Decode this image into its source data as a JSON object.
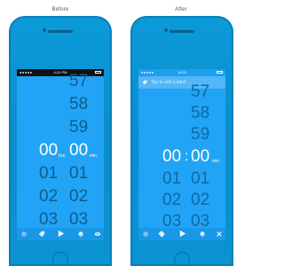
{
  "captions": {
    "before": "Before",
    "after": "After"
  },
  "before": {
    "status_time": "4:21 PM",
    "rows": [
      {
        "hours": "57",
        "minutes": ""
      },
      {
        "hours": "58",
        "minutes": ""
      },
      {
        "hours": "59",
        "minutes": ""
      },
      {
        "hours": "00",
        "minutes": "00"
      },
      {
        "hours": "01",
        "minutes": "01"
      },
      {
        "hours": "02",
        "minutes": "02"
      },
      {
        "hours": "03",
        "minutes": "03"
      }
    ],
    "hours_unit": "hrs",
    "minutes_unit": "min",
    "toolbar_icons": [
      "gear-icon",
      "tag-icon",
      "play-icon",
      "bell-icon",
      "eye-icon"
    ]
  },
  "after": {
    "status_time": "19:21",
    "label_placeholder": "Tap to add a label",
    "rows": [
      {
        "hours": "57",
        "minutes": ""
      },
      {
        "hours": "58",
        "minutes": ""
      },
      {
        "hours": "59",
        "minutes": ""
      },
      {
        "hours": "00",
        "minutes": "00"
      },
      {
        "hours": "01",
        "minutes": "01"
      },
      {
        "hours": "02",
        "minutes": "02"
      },
      {
        "hours": "03",
        "minutes": "03"
      }
    ],
    "separator": ":",
    "minutes_unit": "min",
    "toolbar_icons": [
      "gear-icon",
      "tags-icon",
      "play-icon",
      "bell-icon",
      "close-icon"
    ]
  },
  "colors": {
    "phone_body": "#0b93d2",
    "screen_bg": "#21a4f5",
    "digit_dark": "#0e5d8e",
    "digit_active": "#ffffff",
    "toolbar_bg": "#1a98e8"
  }
}
